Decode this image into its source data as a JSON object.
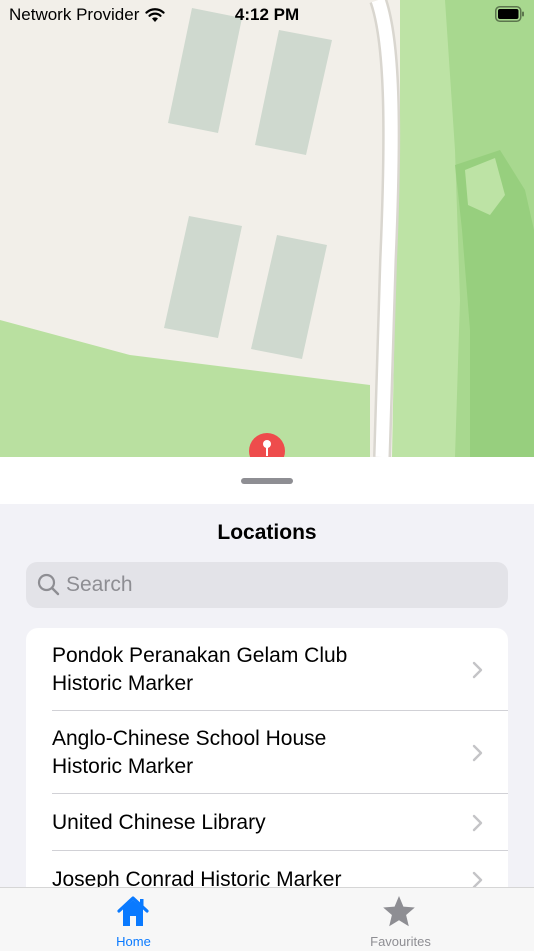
{
  "status": {
    "carrier": "Network Provider",
    "time": "4:12 PM"
  },
  "sheet": {
    "title": "Locations",
    "search": {
      "placeholder": "Search",
      "value": ""
    },
    "locations": [
      {
        "line1": "Pondok Peranakan Gelam Club",
        "line2": "Historic Marker"
      },
      {
        "line1": "Anglo-Chinese School House",
        "line2": "Historic Marker"
      },
      {
        "line1": "United Chinese Library",
        "line2": ""
      },
      {
        "line1": "Joseph Conrad Historic Marker",
        "line2": ""
      }
    ]
  },
  "tabs": [
    {
      "label": "Home",
      "icon": "house-icon",
      "selected": true
    },
    {
      "label": "Favourites",
      "icon": "star-icon",
      "selected": false
    }
  ],
  "colors": {
    "accent": "#0a7aff",
    "inactive": "#8e8e93",
    "pin": "#ee4c4c"
  }
}
